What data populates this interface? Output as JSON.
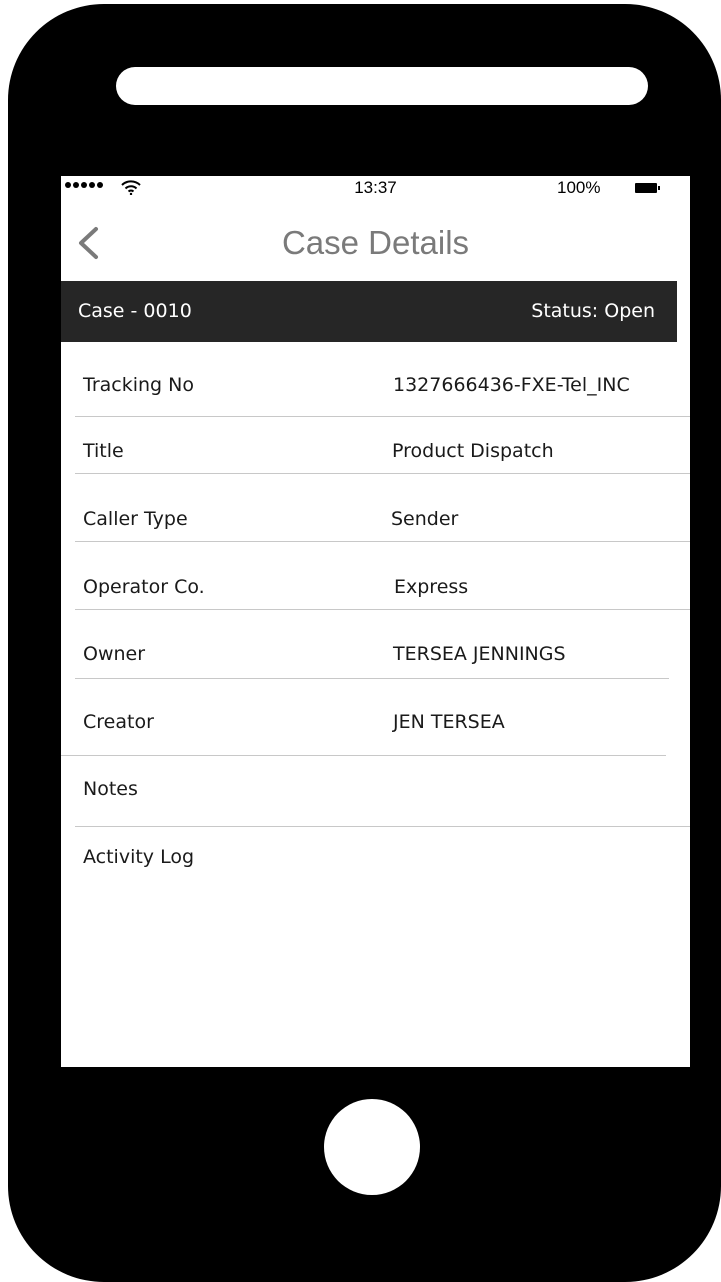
{
  "status_bar": {
    "time": "13:37",
    "battery": "100%"
  },
  "nav": {
    "title": "Case Details"
  },
  "case_header": {
    "case_id": "Case - 0010",
    "status": "Status: Open"
  },
  "fields": [
    {
      "label": "Tracking No",
      "value": "1327666436-FXE-Tel_INC"
    },
    {
      "label": "Title",
      "value": "Product Dispatch"
    },
    {
      "label": "Caller Type",
      "value": "Sender"
    },
    {
      "label": "Operator Co.",
      "value": "Express"
    },
    {
      "label": "Owner",
      "value": "TERSEA JENNINGS"
    },
    {
      "label": "Creator",
      "value": "JEN TERSEA"
    },
    {
      "label": "Notes",
      "value": ""
    },
    {
      "label": "Activity Log",
      "value": ""
    }
  ],
  "colors": {
    "device": "#000000",
    "header_bar": "#262626",
    "nav_title": "#7a7a7a",
    "divider": "#c8c8c8"
  },
  "icons": [
    "signal-dots-icon",
    "wifi-icon",
    "battery-icon",
    "chevron-left-icon"
  ]
}
